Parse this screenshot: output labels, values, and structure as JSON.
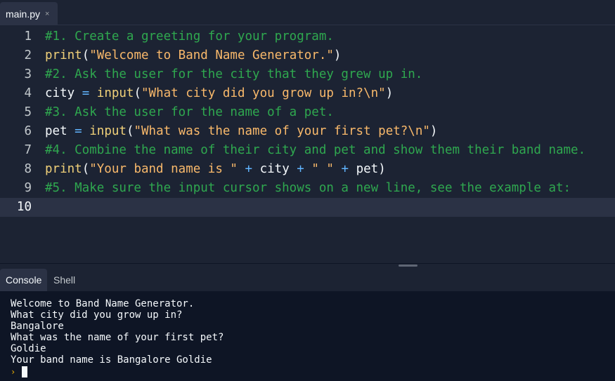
{
  "editor": {
    "tab": {
      "filename": "main.py",
      "close_glyph": "×"
    },
    "lines": [
      {
        "n": "1",
        "tokens": [
          [
            "comment",
            "#1. Create a greeting for your program."
          ]
        ]
      },
      {
        "n": "2",
        "tokens": [
          [
            "func",
            "print"
          ],
          [
            "punc",
            "("
          ],
          [
            "str",
            "\"Welcome to Band Name Generator.\""
          ],
          [
            "punc",
            ")"
          ]
        ]
      },
      {
        "n": "3",
        "tokens": [
          [
            "comment",
            "#2. Ask the user for the city that they grew up in."
          ]
        ]
      },
      {
        "n": "4",
        "tokens": [
          [
            "name",
            "city "
          ],
          [
            "op",
            "="
          ],
          [
            "name",
            " "
          ],
          [
            "func",
            "input"
          ],
          [
            "punc",
            "("
          ],
          [
            "str",
            "\"What city did you grow up in?\\n\""
          ],
          [
            "punc",
            ")"
          ]
        ]
      },
      {
        "n": "5",
        "tokens": [
          [
            "comment",
            "#3. Ask the user for the name of a pet."
          ]
        ]
      },
      {
        "n": "6",
        "tokens": [
          [
            "name",
            "pet "
          ],
          [
            "op",
            "="
          ],
          [
            "name",
            " "
          ],
          [
            "func",
            "input"
          ],
          [
            "punc",
            "("
          ],
          [
            "str",
            "\"What was the name of your first pet?\\n\""
          ],
          [
            "punc",
            ")"
          ]
        ]
      },
      {
        "n": "7",
        "tokens": [
          [
            "comment",
            "#4. Combine the name of their city and pet and show them their band name."
          ]
        ]
      },
      {
        "n": "8",
        "tokens": [
          [
            "func",
            "print"
          ],
          [
            "punc",
            "("
          ],
          [
            "str",
            "\"Your band name is \""
          ],
          [
            "name",
            " "
          ],
          [
            "op",
            "+"
          ],
          [
            "name",
            " city "
          ],
          [
            "op",
            "+"
          ],
          [
            "name",
            " "
          ],
          [
            "str",
            "\" \""
          ],
          [
            "name",
            " "
          ],
          [
            "op",
            "+"
          ],
          [
            "name",
            " pet"
          ],
          [
            "punc",
            ")"
          ]
        ]
      },
      {
        "n": "9",
        "tokens": [
          [
            "comment",
            "#5. Make sure the input cursor shows on a new line, see the example at:"
          ]
        ]
      },
      {
        "n": "10",
        "tokens": [],
        "active": true
      }
    ]
  },
  "console_tabs": [
    {
      "label": "Console",
      "active": true
    },
    {
      "label": "Shell",
      "active": false
    }
  ],
  "console": {
    "lines": [
      "Welcome to Band Name Generator.",
      "What city did you grow up in?",
      "Bangalore",
      "What was the name of your first pet?",
      "Goldie",
      "Your band name is Bangalore Goldie"
    ],
    "prompt_glyph": "›"
  },
  "colors": {
    "background": "#1c2333",
    "console_background": "#0e1525",
    "comment": "#2fa84f",
    "string": "#f9b96b",
    "function": "#f0d079",
    "operator": "#61b5ff",
    "prompt": "#f0b100"
  }
}
